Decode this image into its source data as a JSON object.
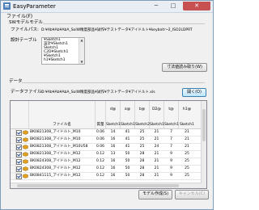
{
  "window": {
    "title": "EasyParameter",
    "min": "─",
    "max": "□",
    "close": "✕"
  },
  "menu": {
    "file": "ファイル(F)"
  },
  "settings": {
    "group_label": "SWモデルモデル",
    "file_label": "ファイルパス:",
    "file_value": "D:¥Ab¥Ab¥AbA_SolW精度部品¥試作¥テストデータ¥アイドルト¥keybolt～2_ISO2LDPRT",
    "table_label": "設計テーブル",
    "tables": [
      "¥Sketch1",
      "設計¥Sketch1",
      "Sketch1",
      "C2D¥Sketch1",
      "¥Sketch1",
      "h1¥Sketch1",
      "h¥Sketch1",
      "h2¥Sketch1"
    ],
    "load_button": "寸法値読み取り(W)"
  },
  "data": {
    "group_label": "データ",
    "file_label": "データファイル:",
    "file_value": "D:¥Ab¥Ab¥AbA_SolW精度部品¥試作¥テストデータ¥アイドルト.xls",
    "open_button": "開く(O)"
  },
  "grid": {
    "columns": [
      {
        "top": "",
        "bottom": ""
      },
      {
        "top": "",
        "bottom": "ファイル名"
      },
      {
        "top": "",
        "bottom": "質量"
      },
      {
        "top": "d@",
        "bottom": "Sketch1"
      },
      {
        "top": "a@",
        "bottom": "Sketch1"
      },
      {
        "top": "b@",
        "bottom": "Sketch2"
      },
      {
        "top": "D2@",
        "bottom": "Sketch1"
      },
      {
        "top": "t@",
        "bottom": "Sketch1"
      },
      {
        "top": "h1@",
        "bottom": "Sketch1"
      }
    ],
    "rows": [
      {
        "num": "1",
        "file": "BK0821308_アイドルト_M10",
        "mass": "0.06",
        "d": "14",
        "a": "41",
        "b": "25",
        "d2": "21",
        "t": "7",
        "h1": "21"
      },
      {
        "num": "2",
        "file": "BK0821308_アイドルト_M10",
        "mass": "0.06",
        "d": "16",
        "a": "41",
        "b": "25",
        "d2": "21",
        "t": "7",
        "h1": "21"
      },
      {
        "num": "3",
        "file": "BK0821308_アイドルト_M10U58",
        "mass": "0.06",
        "d": "16",
        "a": "41",
        "b": "25",
        "d2": "24",
        "t": "7",
        "h1": "21"
      },
      {
        "num": "4",
        "file": "BK0821308_アイドルト_M12",
        "mass": "0.12",
        "d": "13",
        "a": "50",
        "b": "28",
        "d2": "21",
        "t": "9",
        "h1": "25"
      },
      {
        "num": "5",
        "file": "BK0824308_アイドルト_M12",
        "mass": "0.12",
        "d": "16",
        "a": "50",
        "b": "28",
        "d2": "21",
        "t": "9",
        "h1": "25"
      },
      {
        "num": "6",
        "file": "BK0824308_アイドルト_M12",
        "mass": "0.12",
        "d": "16",
        "a": "50",
        "b": "28",
        "d2": "21",
        "t": "9",
        "h1": "25"
      },
      {
        "num": "7",
        "file": "BK0841115_アイドルト_M12",
        "mass": "0.12",
        "d": "16",
        "a": "50",
        "b": "28",
        "d2": "21",
        "t": "9",
        "h1": "25"
      }
    ]
  },
  "footer": {
    "create_button": "モデル作成(S)",
    "cancel_button": "キャンセル(C)"
  },
  "colors": {
    "accent": "#3c7fb1",
    "close": "#c75050"
  }
}
